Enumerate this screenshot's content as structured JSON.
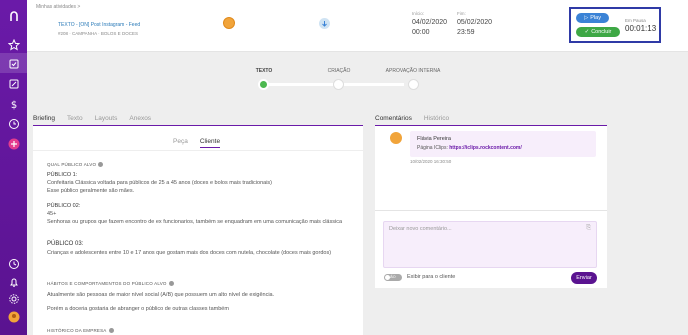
{
  "sidebar": {
    "icons": [
      "brand-logo-icon",
      "star-icon",
      "task-icon",
      "edit-icon",
      "dollar-icon",
      "clock-icon",
      "plus-icon",
      "history-icon",
      "bell-icon",
      "gear-icon",
      "user-avatar"
    ]
  },
  "header": {
    "breadcrumb": "Minhas atividades  >",
    "task_title": "TEXTO - [ON] Post Instagram - Feed",
    "task_sub": "#208 · CAMPANHA · BOLOS E DOCES",
    "start_label": "Início:",
    "start_date": "04/02/2020",
    "start_time": "00:00",
    "end_label": "Fim:",
    "end_date": "05/02/2020",
    "end_time": "23:59",
    "play_label": "Play",
    "concluir_label": "Concluir",
    "timer_label": "Em Pausa",
    "timer_value": "00:01:13"
  },
  "stepper": {
    "steps": [
      {
        "label": "TEXTO",
        "state": "done"
      },
      {
        "label": "CRIAÇÃO",
        "state": "pending"
      },
      {
        "label": "APROVAÇÃO INTERNA",
        "state": "pending"
      }
    ]
  },
  "tabs": [
    "Briefing",
    "Texto",
    "Layouts",
    "Anexos"
  ],
  "active_tab": "Briefing",
  "subtabs": [
    "Peça",
    "Cliente"
  ],
  "active_subtab": "Cliente",
  "briefing": {
    "qual_publico_h": "QUAL PÚBLICO ALVO",
    "publico1_lbl": "PÚBLICO 1:",
    "publico1_txt": "Confeitaria Clássica voltada para públicos de 25 a 45 anos (doces e bolos mais tradicionais)",
    "publico1_txt2": "Esse público geralmente são mães.",
    "publico2_lbl": "PÚBLICO 02:",
    "publico2_txt": "45+",
    "publico2_txt2": "Senhoras ou grupos que fazem encontro de ex funcionarios, também se enquadram em uma comunicação mais clássica",
    "publico3_lbl": "PÚBLICO 03:",
    "publico3_txt": "Crianças e adolescentes entre 10 e 17 anos que gostam mais dos doces com nutela, chocolate  (doces mais gordos)",
    "habitos_h": "HÁBITOS E COMPORTAMENTOS DO PÚBLICO ALVO",
    "habitos_txt": "Atualmente são pessoas de maior nível social (A/B) que possuem um alto nível de exigência.",
    "habitos_txt2": "Porém a doceria gostaria de abranger o público de outras classes também",
    "historico_h": "HISTÓRICO DA EMPRESA"
  },
  "right_tabs": [
    "Comentários",
    "Histórico"
  ],
  "active_right_tab": "Comentários",
  "comment": {
    "author": "Flávia Pereira",
    "text_prefix": "Página IClips: ",
    "link": "https://iclips.rockcontent.com/",
    "time": "10/02/2020 16:30:50"
  },
  "comment_input": {
    "placeholder": "Deixar novo comentário...",
    "toggle_state": "NÃO",
    "toggle_label": "Exibir para o cliente",
    "send_label": "Enviar"
  }
}
